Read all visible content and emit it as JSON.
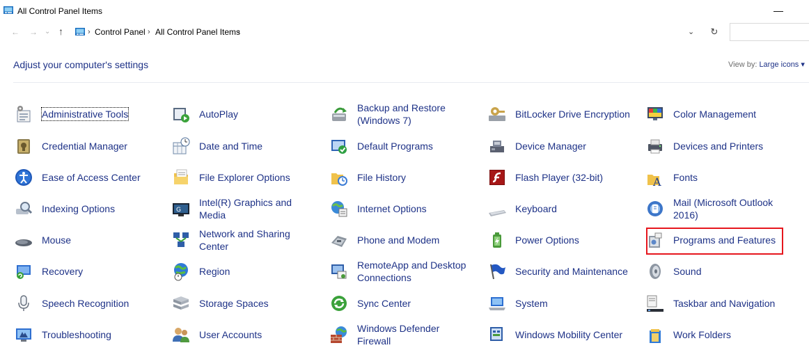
{
  "window": {
    "title": "All Control Panel Items"
  },
  "nav": {
    "back": "←",
    "forward": "→",
    "recent": "⌄",
    "up": "↑",
    "crumb_sep": "›",
    "breadcrumbs": [
      "Control Panel",
      "All Control Panel Items"
    ],
    "dropdown": "⌄",
    "refresh": "↻"
  },
  "header": {
    "title": "Adjust your computer's settings",
    "view_by_label": "View by:",
    "view_by_value": "Large icons"
  },
  "items": [
    {
      "label": "Administrative Tools",
      "icon": "administrative-tools-icon"
    },
    {
      "label": "AutoPlay",
      "icon": "autoplay-icon"
    },
    {
      "label": "Backup and Restore",
      "label2": "(Windows 7)",
      "icon": "backup-restore-icon"
    },
    {
      "label": "BitLocker Drive Encryption",
      "icon": "bitlocker-icon"
    },
    {
      "label": "Color Management",
      "icon": "color-management-icon"
    },
    {
      "label": "Credential Manager",
      "icon": "credential-manager-icon"
    },
    {
      "label": "Date and Time",
      "icon": "date-time-icon"
    },
    {
      "label": "Default Programs",
      "icon": "default-programs-icon"
    },
    {
      "label": "Device Manager",
      "icon": "device-manager-icon"
    },
    {
      "label": "Devices and Printers",
      "icon": "devices-printers-icon"
    },
    {
      "label": "Ease of Access Center",
      "icon": "ease-of-access-icon"
    },
    {
      "label": "File Explorer Options",
      "icon": "file-explorer-options-icon"
    },
    {
      "label": "File History",
      "icon": "file-history-icon"
    },
    {
      "label": "Flash Player (32-bit)",
      "icon": "flash-player-icon"
    },
    {
      "label": "Fonts",
      "icon": "fonts-icon"
    },
    {
      "label": "Indexing Options",
      "icon": "indexing-options-icon"
    },
    {
      "label": "Intel(R) Graphics and",
      "label2": "Media",
      "icon": "intel-graphics-icon"
    },
    {
      "label": "Internet Options",
      "icon": "internet-options-icon"
    },
    {
      "label": "Keyboard",
      "icon": "keyboard-icon"
    },
    {
      "label": "Mail (Microsoft Outlook",
      "label2": "2016)",
      "icon": "mail-icon"
    },
    {
      "label": "Mouse",
      "icon": "mouse-icon"
    },
    {
      "label": "Network and Sharing",
      "label2": "Center",
      "icon": "network-sharing-icon"
    },
    {
      "label": "Phone and Modem",
      "icon": "phone-modem-icon"
    },
    {
      "label": "Power Options",
      "icon": "power-options-icon"
    },
    {
      "label": "Programs and Features",
      "icon": "programs-features-icon"
    },
    {
      "label": "Recovery",
      "icon": "recovery-icon"
    },
    {
      "label": "Region",
      "icon": "region-icon"
    },
    {
      "label": "RemoteApp and Desktop",
      "label2": "Connections",
      "icon": "remoteapp-icon"
    },
    {
      "label": "Security and Maintenance",
      "icon": "security-maintenance-icon"
    },
    {
      "label": "Sound",
      "icon": "sound-icon"
    },
    {
      "label": "Speech Recognition",
      "icon": "speech-recognition-icon"
    },
    {
      "label": "Storage Spaces",
      "icon": "storage-spaces-icon"
    },
    {
      "label": "Sync Center",
      "icon": "sync-center-icon"
    },
    {
      "label": "System",
      "icon": "system-icon"
    },
    {
      "label": "Taskbar and Navigation",
      "icon": "taskbar-navigation-icon"
    },
    {
      "label": "Troubleshooting",
      "icon": "troubleshooting-icon"
    },
    {
      "label": "User Accounts",
      "icon": "user-accounts-icon"
    },
    {
      "label": "Windows Defender",
      "label2": "Firewall",
      "icon": "windows-firewall-icon"
    },
    {
      "label": "Windows Mobility Center",
      "icon": "windows-mobility-icon"
    },
    {
      "label": "Work Folders",
      "icon": "work-folders-icon"
    }
  ]
}
